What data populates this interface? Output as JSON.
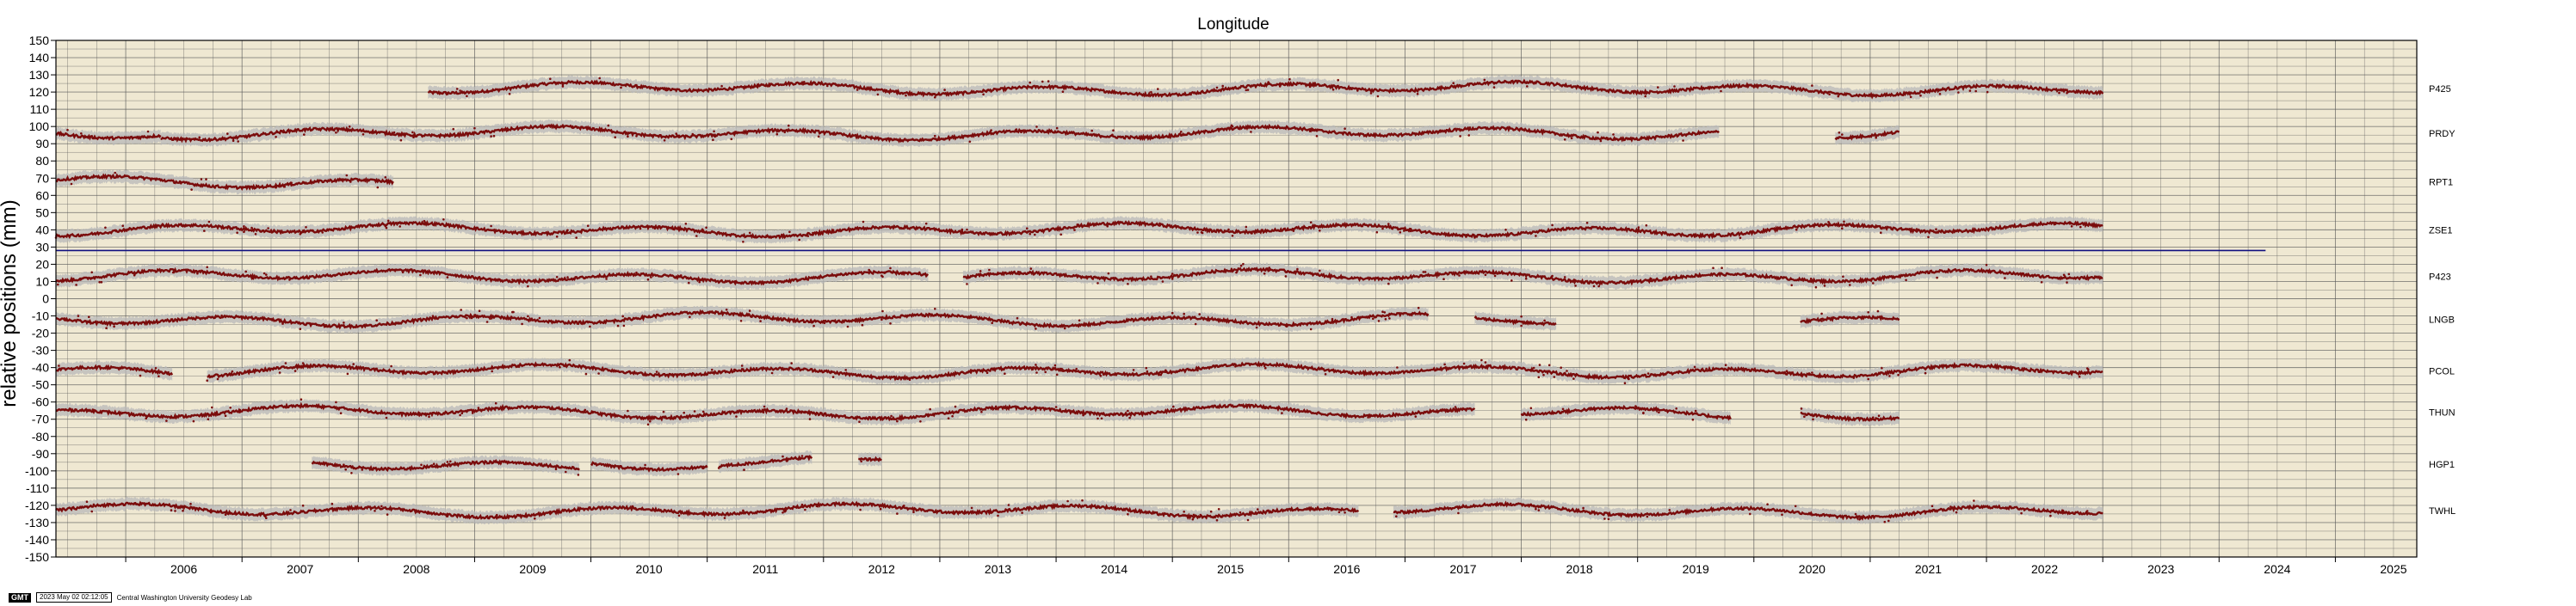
{
  "chart_data": {
    "type": "scatter",
    "title": "Longitude",
    "ylabel": "relative positions (mm)",
    "xlabel": "",
    "xlim": [
      2005.4,
      2025.7
    ],
    "ylim": [
      -150,
      150
    ],
    "x_ticks": [
      "2006",
      "2007",
      "2008",
      "2009",
      "2010",
      "2011",
      "2012",
      "2013",
      "2014",
      "2015",
      "2016",
      "2017",
      "2018",
      "2019",
      "2020",
      "2021",
      "2022",
      "2023",
      "2024",
      "2025"
    ],
    "y_ticks": [
      "150",
      "140",
      "130",
      "120",
      "110",
      "100",
      "90",
      "80",
      "70",
      "60",
      "50",
      "40",
      "30",
      "20",
      "10",
      "0",
      "-10",
      "-20",
      "-30",
      "-40",
      "-50",
      "-60",
      "-70",
      "-80",
      "-90",
      "-100",
      "-110",
      "-120",
      "-130",
      "-140",
      "-150"
    ],
    "grid": true,
    "colors": {
      "background": "#efe8d2",
      "points": "#7a0c0c",
      "error_band": "#b8b8b8",
      "reference_line": "#101080",
      "grid": "#555555"
    },
    "reference_line": {
      "y": 28,
      "x_end": 2024.4
    },
    "series": [
      {
        "name": "P425",
        "offset": 122,
        "segments": [
          [
            2008.6,
            2023.0
          ]
        ]
      },
      {
        "name": "PRDY",
        "offset": 96,
        "segments": [
          [
            2005.4,
            2006.3
          ],
          [
            2006.3,
            2019.7
          ],
          [
            2020.7,
            2021.25
          ]
        ]
      },
      {
        "name": "RPT1",
        "offset": 68,
        "segments": [
          [
            2005.4,
            2008.3
          ]
        ]
      },
      {
        "name": "ZSE1",
        "offset": 40,
        "segments": [
          [
            2005.4,
            2023.0
          ]
        ]
      },
      {
        "name": "P423",
        "offset": 13,
        "segments": [
          [
            2005.4,
            2012.9
          ],
          [
            2013.2,
            2023.0
          ]
        ]
      },
      {
        "name": "LNGB",
        "offset": -12,
        "segments": [
          [
            2005.4,
            2017.2
          ],
          [
            2017.6,
            2018.3
          ],
          [
            2020.4,
            2021.25
          ]
        ]
      },
      {
        "name": "PCOL",
        "offset": -42,
        "segments": [
          [
            2005.4,
            2006.4
          ],
          [
            2006.7,
            2023.0
          ]
        ]
      },
      {
        "name": "THUN",
        "offset": -66,
        "segments": [
          [
            2005.4,
            2017.6
          ],
          [
            2018.0,
            2019.8
          ],
          [
            2020.4,
            2021.25
          ]
        ]
      },
      {
        "name": "HGP1",
        "offset": -96,
        "segments": [
          [
            2007.6,
            2009.9
          ],
          [
            2010.0,
            2011.0
          ],
          [
            2011.1,
            2011.9
          ],
          [
            2012.3,
            2012.5
          ]
        ]
      },
      {
        "name": "TWHL",
        "offset": -123,
        "segments": [
          [
            2005.4,
            2016.6
          ],
          [
            2016.9,
            2023.0
          ]
        ]
      }
    ]
  },
  "footer": {
    "logo": "GMT",
    "timestamp": "2023 May 02 02:12:05",
    "credit": "Central Washington University Geodesy Lab"
  }
}
